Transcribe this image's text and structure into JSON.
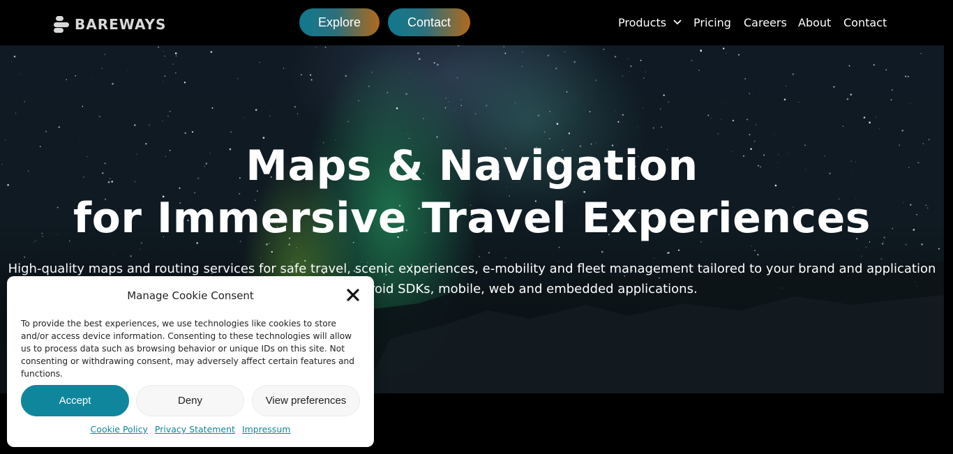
{
  "header": {
    "logo_text": "BAREWAYS",
    "explore_label": "Explore",
    "contact_pill_label": "Contact",
    "nav": {
      "products": "Products",
      "pricing": "Pricing",
      "careers": "Careers",
      "about": "About",
      "contact": "Contact"
    }
  },
  "hero": {
    "title_line1": "Maps & Navigation",
    "title_line2": "for Immersive Travel Experiences",
    "subtitle_line1": "High-quality maps and routing services for safe travel, scenic experiences, e-mobility and fleet management tailored to your brand and application",
    "subtitle_line2": "y APIs, iOS and Android SDKs, mobile, web and embedded applications."
  },
  "cookie": {
    "title": "Manage Cookie Consent",
    "body": "To provide the best experiences, we use technologies like cookies to store and/or access device information. Consenting to these technologies will allow us to process data such as browsing behavior or unique IDs on this site. Not consenting or withdrawing consent, may adversely affect certain features and functions.",
    "accept_label": "Accept",
    "deny_label": "Deny",
    "prefs_label": "View preferences",
    "links": {
      "cookie_policy": "Cookie Policy",
      "privacy": "Privacy Statement",
      "impressum": "Impressum"
    }
  },
  "colors": {
    "accent": "#10869c",
    "pill_start": "#0f7a8f",
    "pill_end": "#b06a1c"
  }
}
